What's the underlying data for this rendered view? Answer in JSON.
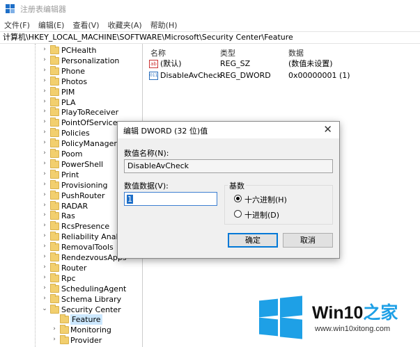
{
  "window": {
    "title": "注册表编辑器"
  },
  "menu": [
    "文件(F)",
    "编辑(E)",
    "查看(V)",
    "收藏夹(A)",
    "帮助(H)"
  ],
  "address": "计算机\\HKEY_LOCAL_MACHINE\\SOFTWARE\\Microsoft\\Security Center\\Feature",
  "tree": {
    "items": [
      "PCHealth",
      "Personalization",
      "Phone",
      "Photos",
      "PIM",
      "PLA",
      "PlayToReceiver",
      "PointOfService",
      "Policies",
      "PolicyManager",
      "Poom",
      "PowerShell",
      "Print",
      "Provisioning",
      "PushRouter",
      "RADAR",
      "Ras",
      "RcsPresence",
      "Reliability Analysis",
      "RemovalTools",
      "RendezvousApps",
      "Router",
      "Rpc",
      "SchedulingAgent",
      "Schema Library",
      "Security Center"
    ],
    "children": [
      "Feature",
      "Monitoring",
      "Provider"
    ]
  },
  "list": {
    "headers": {
      "name": "名称",
      "type": "类型",
      "data": "数据"
    },
    "rows": [
      {
        "icon": "string-value-icon",
        "icon_text": "ab",
        "name": "(默认)",
        "type": "REG_SZ",
        "data": "(数值未设置)"
      },
      {
        "icon": "binary-value-icon",
        "icon_text": "011",
        "name": "DisableAvCheck",
        "type": "REG_DWORD",
        "data": "0x00000001 (1)"
      }
    ]
  },
  "dialog": {
    "title": "编辑 DWORD (32 位)值",
    "close": "✕",
    "name_label": "数值名称(N):",
    "name_value": "DisableAvCheck",
    "data_label": "数值数据(V):",
    "data_value": "1",
    "base_label": "基数",
    "hex_label": "十六进制(H)",
    "dec_label": "十进制(D)",
    "base_selected": "hex",
    "ok": "确定",
    "cancel": "取消"
  },
  "watermark": {
    "brand": "Win10",
    "brand_cn": "之家",
    "url": "www.win10xitong.com"
  },
  "colors": {
    "accent": "#1e6fc8",
    "selection": "#cce8ff",
    "logo": "#1ea0e6",
    "folder": "#f2cf6e"
  }
}
